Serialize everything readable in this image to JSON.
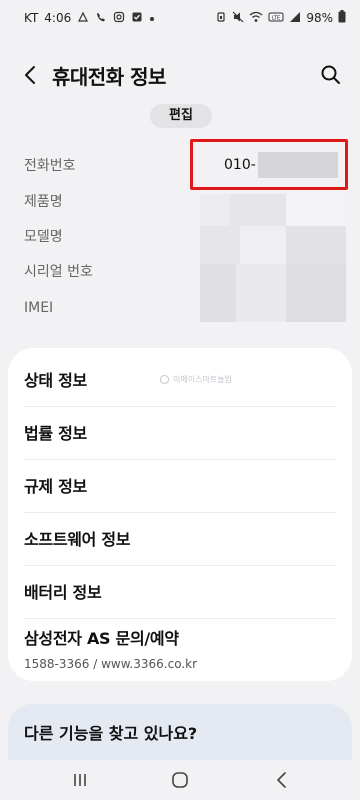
{
  "status_bar": {
    "carrier": "KT",
    "time": "4:06",
    "battery": "98%",
    "icons_left": [
      "notification-icon",
      "call-icon",
      "instagram-icon",
      "checkbox-icon",
      "dot-icon"
    ],
    "icons_right": [
      "alarm-icon",
      "mute-icon",
      "wifi-icon",
      "volte-icon",
      "signal-icon"
    ]
  },
  "header": {
    "title": "휴대전화 정보",
    "back_icon": "chevron-left-icon",
    "search_icon": "search-icon"
  },
  "edit_label": "편집",
  "info": {
    "rows": [
      {
        "label": "전화번호"
      },
      {
        "label": "제품명"
      },
      {
        "label": "모델명"
      },
      {
        "label": "시리얼 번호"
      },
      {
        "label": "IMEI"
      }
    ],
    "phone_prefix": "010-"
  },
  "watermark": "이메이스마트놀업",
  "menu": [
    {
      "label": "상태 정보"
    },
    {
      "label": "법률 정보"
    },
    {
      "label": "규제 정보"
    },
    {
      "label": "소프트웨어 정보"
    },
    {
      "label": "배터리 정보"
    },
    {
      "label": "삼성전자 AS 문의/예약",
      "sub": "1588-3366 / www.3366.co.kr"
    }
  ],
  "bottom_card": {
    "title": "다른 기능을 찾고 있나요?"
  },
  "colors": {
    "background": "#f2f2f4",
    "card": "#ffffff",
    "highlight": "#e01818",
    "bottom_card": "#e4e9f2"
  },
  "nav_bar": [
    "recents-icon",
    "home-icon",
    "back-icon"
  ]
}
